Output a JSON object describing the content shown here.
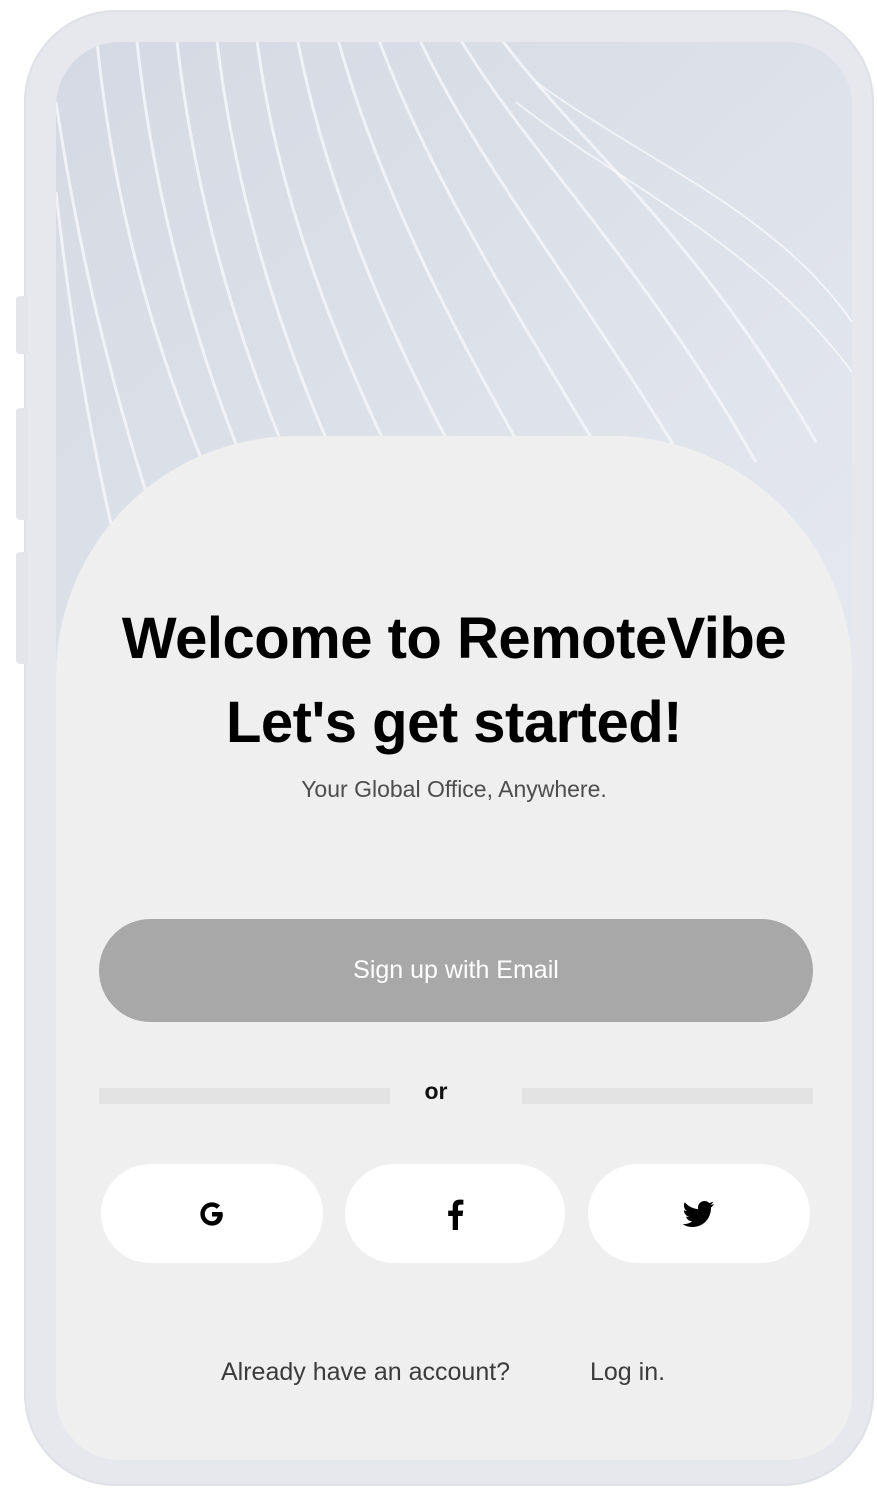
{
  "welcome": {
    "title_line1": "Welcome to RemoteVibe",
    "title_line2": "Let's get started!",
    "subtitle": "Your Global Office, Anywhere."
  },
  "actions": {
    "signup_label": "Sign up with Email",
    "divider_label": "or"
  },
  "social": [
    {
      "icon": "google-icon"
    },
    {
      "icon": "facebook-icon"
    },
    {
      "icon": "twitter-icon"
    }
  ],
  "footer": {
    "prompt": "Already have an account?",
    "login_label": "Log in."
  },
  "colors": {
    "background_card": "#efefef",
    "signup_button": "#a8a8a8",
    "social_button": "#ffffff",
    "text_primary": "#000000"
  }
}
